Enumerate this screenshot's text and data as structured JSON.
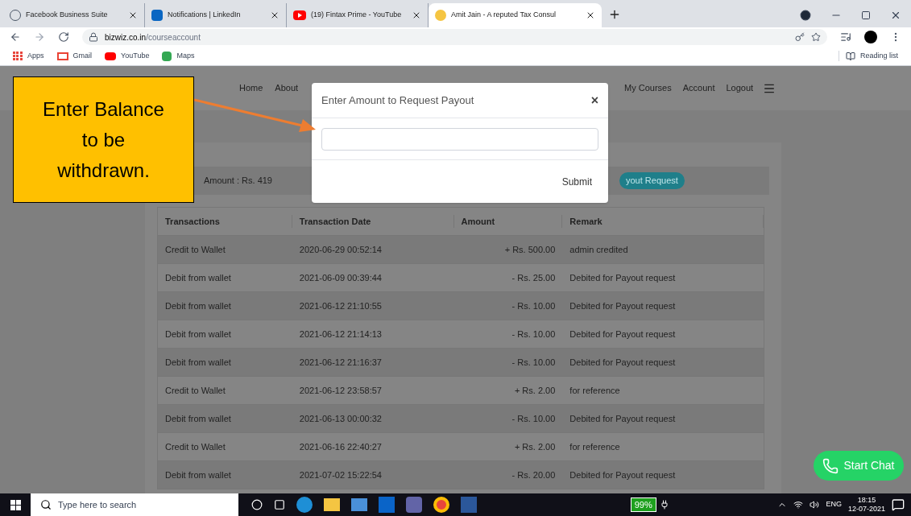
{
  "tabs": [
    {
      "title": "Facebook Business Suite",
      "selected": false
    },
    {
      "title": "Notifications | LinkedIn",
      "selected": false
    },
    {
      "title": "(19) Fintax Prime - YouTube",
      "selected": false
    },
    {
      "title": "Amit Jain - A reputed Tax Consul",
      "selected": true
    }
  ],
  "address": {
    "host": "bizwiz.co.in",
    "path": "/courseaccount"
  },
  "bookmarks": [
    {
      "label": "Apps"
    },
    {
      "label": "Gmail"
    },
    {
      "label": "YouTube"
    },
    {
      "label": "Maps"
    }
  ],
  "reading_list": "Reading list",
  "nav": {
    "left": [
      "Home",
      "About"
    ],
    "right": [
      "My Courses",
      "Account",
      "Logout"
    ]
  },
  "balance": {
    "text": "Amount : Rs. 419",
    "button": "yout Request"
  },
  "table": {
    "columns": [
      "Transactions",
      "Transaction Date",
      "Amount",
      "Remark"
    ],
    "rows": [
      [
        "Credit to Wallet",
        "2020-06-29 00:52:14",
        "+ Rs. 500.00",
        "admin credited"
      ],
      [
        "Debit from wallet",
        "2021-06-09 00:39:44",
        "- Rs. 25.00",
        "Debited for Payout request"
      ],
      [
        "Debit from wallet",
        "2021-06-12 21:10:55",
        "- Rs. 10.00",
        "Debited for Payout request"
      ],
      [
        "Debit from wallet",
        "2021-06-12 21:14:13",
        "- Rs. 10.00",
        "Debited for Payout request"
      ],
      [
        "Debit from wallet",
        "2021-06-12 21:16:37",
        "- Rs. 10.00",
        "Debited for Payout request"
      ],
      [
        "Credit to Wallet",
        "2021-06-12 23:58:57",
        "+ Rs. 2.00",
        "for reference"
      ],
      [
        "Debit from wallet",
        "2021-06-13 00:00:32",
        "- Rs. 10.00",
        "Debited for Payout request"
      ],
      [
        "Credit to Wallet",
        "2021-06-16 22:40:27",
        "+ Rs. 2.00",
        "for reference"
      ],
      [
        "Debit from wallet",
        "2021-07-02 15:22:54",
        "- Rs. 20.00",
        "Debited for Payout request"
      ]
    ]
  },
  "modal": {
    "title": "Enter Amount to Request Payout",
    "close": "×",
    "submit": "Submit"
  },
  "callout": {
    "text": "Enter Balance to be withdrawn."
  },
  "chat_button": "Start Chat",
  "taskbar": {
    "search_placeholder": "Type here to search",
    "battery": "99%",
    "language": "ENG",
    "time": "18:15",
    "date": "12-07-2021"
  }
}
